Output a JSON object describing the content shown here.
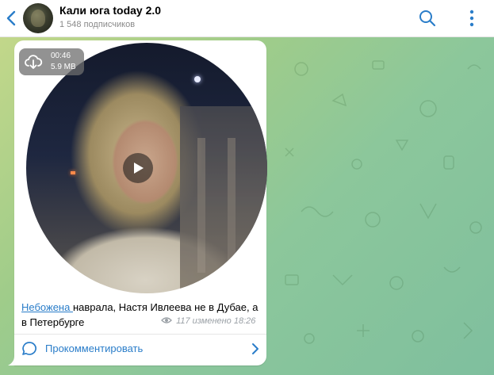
{
  "header": {
    "title": "Кали юга today 2.0",
    "subscribers": "1 548 подписчиков",
    "back_icon": "chevron-left-icon",
    "search_icon": "search-icon",
    "more_icon": "more-vertical-icon"
  },
  "message": {
    "video": {
      "duration": "00:46",
      "size": "5.9 MB",
      "download_icon": "cloud-download-icon",
      "play_icon": "play-icon"
    },
    "caption_link": "Небожена ",
    "caption_text": "наврала, Настя Ивлеева не в Дубае, а в Петербурге",
    "views": "117",
    "edited_time": "изменено 18:26",
    "comment_label": "Прокомментировать"
  },
  "colors": {
    "accent": "#2a7dc9",
    "bubble": "#ffffff"
  }
}
